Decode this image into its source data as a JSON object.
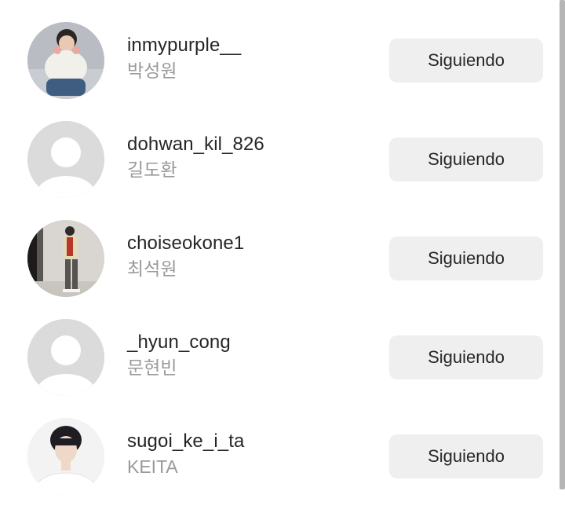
{
  "following_list": {
    "items": [
      {
        "username": "inmypurple__",
        "full_name": "박성원",
        "button_label": "Siguiendo",
        "avatar": "photo-person-sitting"
      },
      {
        "username": "dohwan_kil_826",
        "full_name": "길도환",
        "button_label": "Siguiendo",
        "avatar": "default-avatar"
      },
      {
        "username": "choiseokone1",
        "full_name": "최석원",
        "button_label": "Siguiendo",
        "avatar": "photo-person-standing"
      },
      {
        "username": "_hyun_cong",
        "full_name": "문현빈",
        "button_label": "Siguiendo",
        "avatar": "default-avatar"
      },
      {
        "username": "sugoi_ke_i_ta",
        "full_name": "KEITA",
        "button_label": "Siguiendo",
        "avatar": "photo-portrait"
      }
    ]
  },
  "colors": {
    "button_bg": "#efefef",
    "username": "#262626",
    "full_name": "#9a9a9a",
    "default_avatar_bg": "#dbdbdb"
  }
}
